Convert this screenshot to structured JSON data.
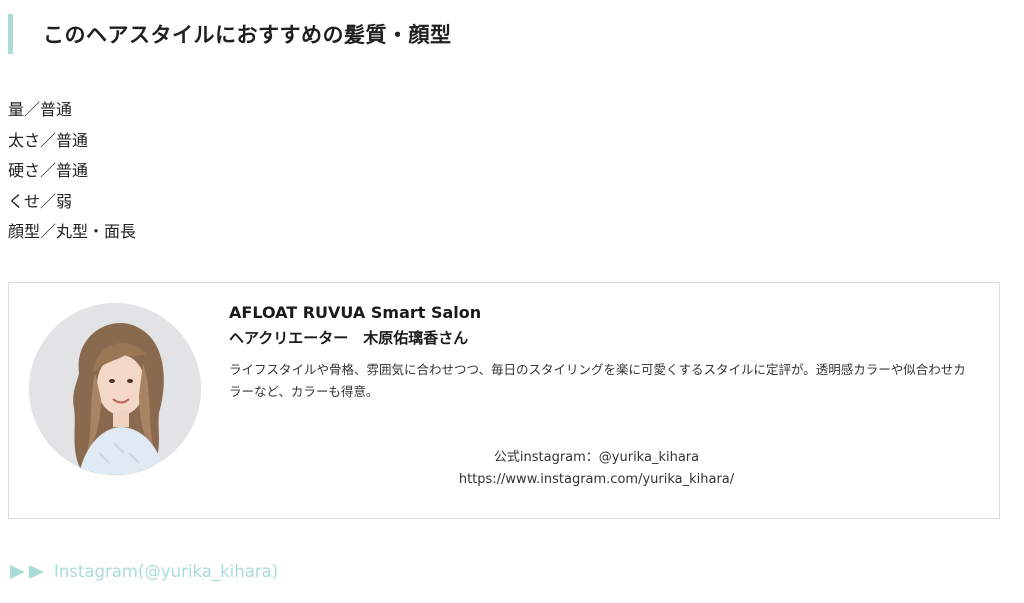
{
  "heading": {
    "title": "このヘアスタイルにおすすめの髪質・顔型"
  },
  "attributes": [
    "量／普通",
    "太さ／普通",
    "硬さ／普通",
    "くせ／弱",
    "顔型／丸型・面長"
  ],
  "profile": {
    "salon": "AFLOAT RUVUA Smart Salon",
    "stylist": "ヘアクリエーター　木原佑璃香さん",
    "bio": "ライフスタイルや骨格、雰囲気に合わせつつ、毎日のスタイリングを楽に可愛くするスタイルに定評が。透明感カラーや似合わせカラーなど、カラーも得意。",
    "instagram_label": "公式instagram：@yurika_kihara",
    "instagram_url": "https://www.instagram.com/yurika_kihara/"
  },
  "link": {
    "label": "Instagram(@yurika_kihara)"
  },
  "colors": {
    "accent": "#a9dcd7",
    "border": "#dddddd",
    "text": "#222222"
  },
  "icons": {
    "link_arrows": "double-play-arrow-icon"
  }
}
